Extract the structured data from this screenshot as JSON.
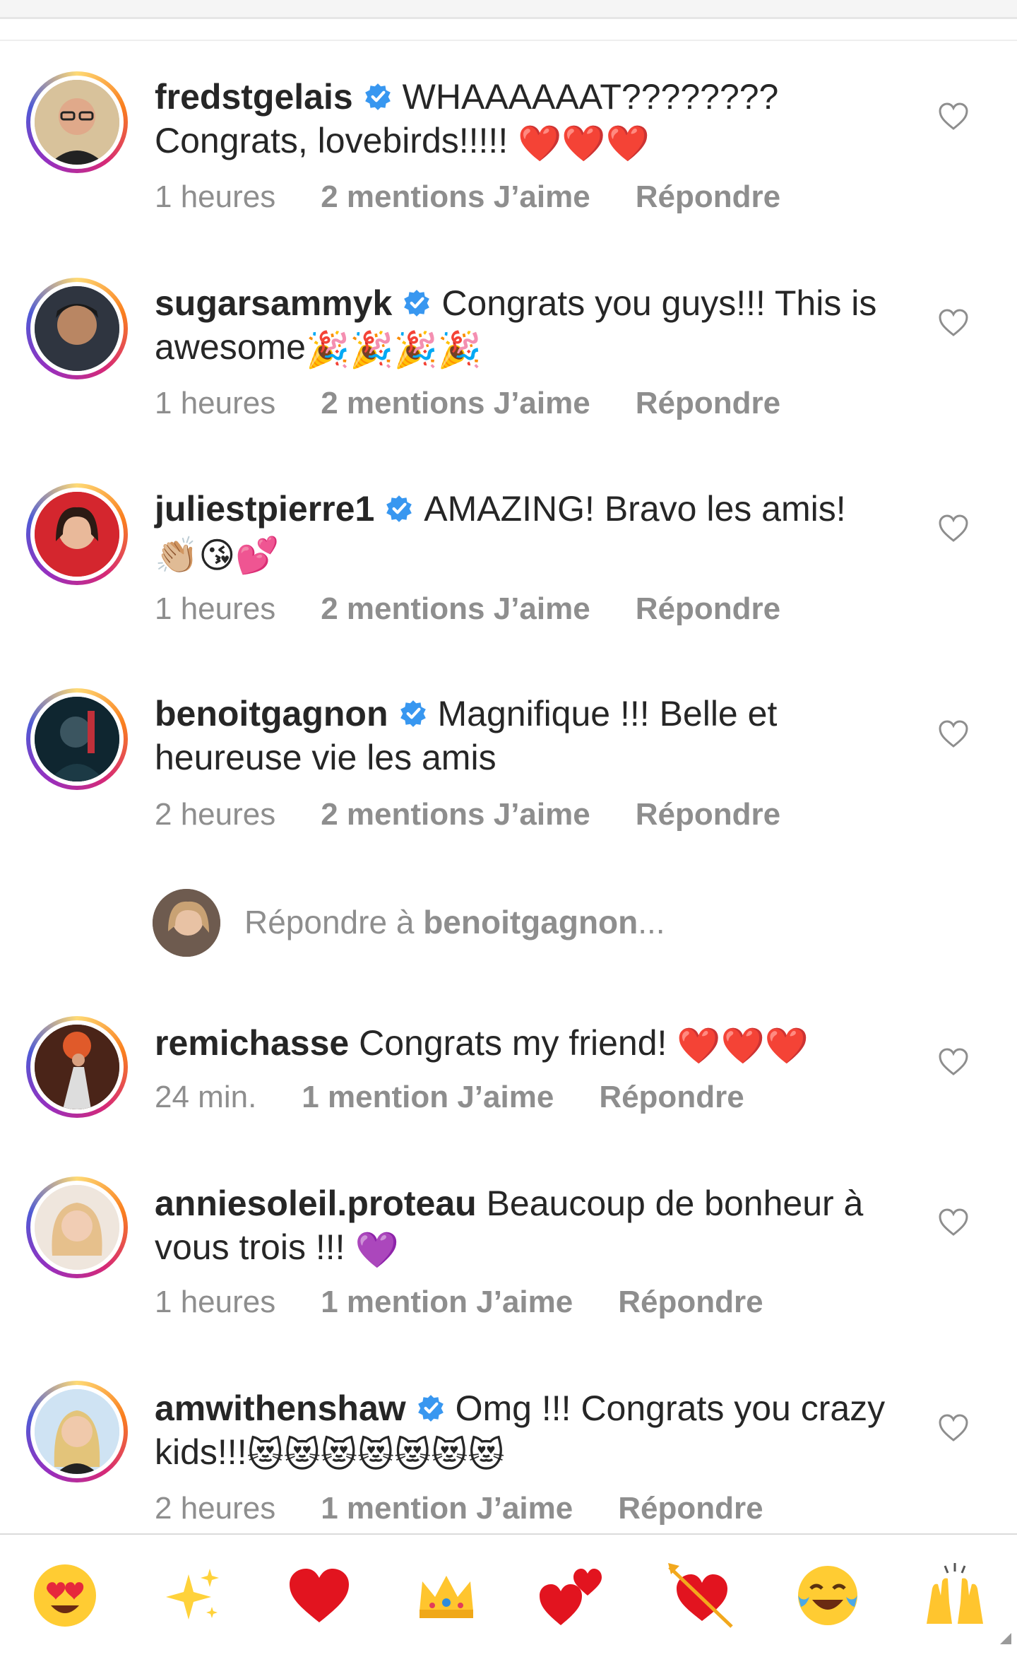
{
  "comments": [
    {
      "user": "fredstgelais",
      "verified": true,
      "text": "WHAAAAAAT???????? Congrats, lovebirds!!!!! ",
      "emoji": "❤️❤️❤️",
      "time": "1 heures",
      "likes": "2 mentions J’aime",
      "reply": "Répondre"
    },
    {
      "user": "sugarsammyk",
      "verified": true,
      "text": "Congrats you guys!!! This is awesome",
      "emoji": "🎉🎉🎉🎉",
      "time": "1 heures",
      "likes": "2 mentions J’aime",
      "reply": "Répondre"
    },
    {
      "user": "juliestpierre1",
      "verified": true,
      "text": "AMAZING! Bravo les amis! ",
      "emoji": "👏🏼😘💕",
      "time": "1 heures",
      "likes": "2 mentions J’aime",
      "reply": "Répondre"
    },
    {
      "user": "benoitgagnon",
      "verified": true,
      "text": "Magnifique !!! Belle et heureuse vie les amis",
      "emoji": "",
      "time": "2 heures",
      "likes": "2 mentions J’aime",
      "reply": "Répondre"
    },
    {
      "user": "remichasse",
      "verified": false,
      "text": "Congrats my friend! ",
      "emoji": "❤️❤️❤️",
      "time": "24 min.",
      "likes": "1 mention J’aime",
      "reply": "Répondre"
    },
    {
      "user": "anniesoleil.proteau",
      "verified": false,
      "text": "Beaucoup de bonheur à vous trois !!! ",
      "emoji": "💜",
      "time": "1 heures",
      "likes": "1 mention J’aime",
      "reply": "Répondre"
    },
    {
      "user": "amwithenshaw",
      "verified": true,
      "text": "Omg !!! Congrats you crazy kids!!!",
      "emoji": "😻😻😻😻😻😻😻",
      "time": "2 heures",
      "likes": "1 mention J’aime",
      "reply": "Répondre"
    }
  ],
  "reply_box": {
    "prefix": "Répondre à ",
    "target": "benoitgagnon",
    "suffix": "..."
  },
  "emoji_bar": [
    "😍",
    "✨",
    "❤️",
    "👑",
    "💕",
    "💘",
    "😂",
    "🙌"
  ],
  "colors": {
    "verified": "#3897f0",
    "muted": "#8e8e8e",
    "text": "#262626"
  }
}
